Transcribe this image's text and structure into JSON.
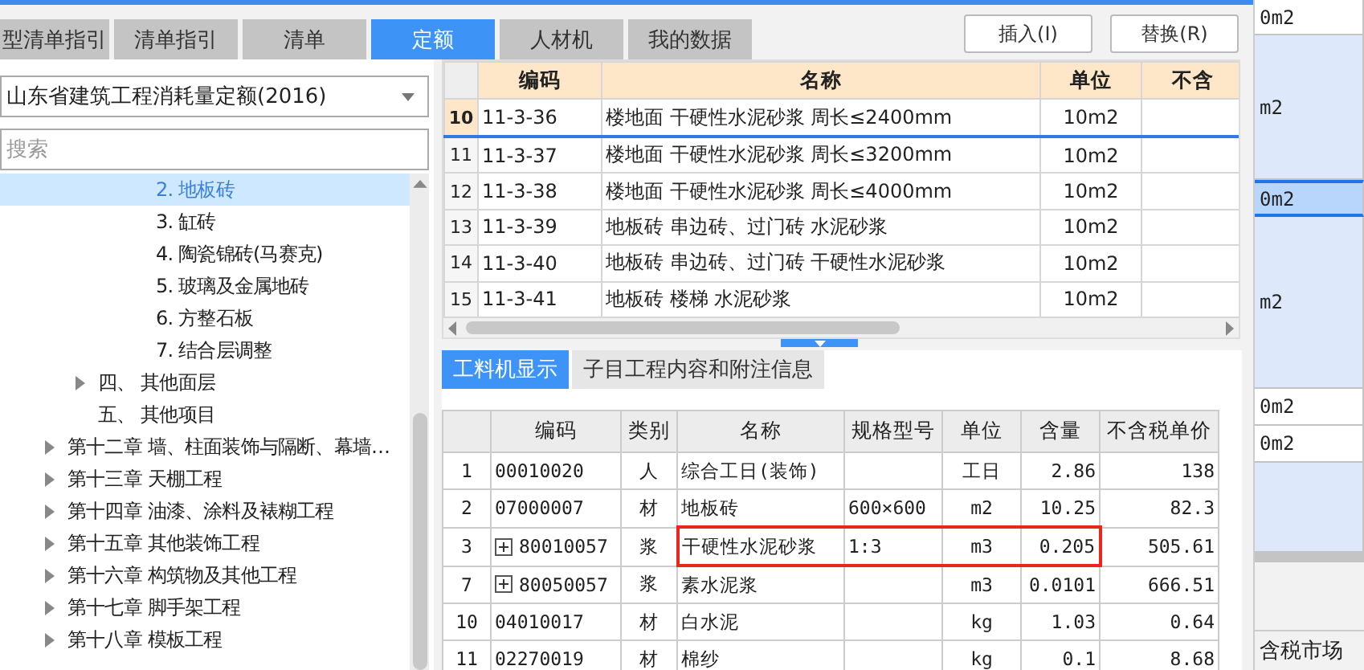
{
  "tabs": [
    {
      "label": "型清单指引",
      "selected": false
    },
    {
      "label": "清单指引",
      "selected": false
    },
    {
      "label": "清单",
      "selected": false
    },
    {
      "label": "定额",
      "selected": true
    },
    {
      "label": "人材机",
      "selected": false
    },
    {
      "label": "我的数据",
      "selected": false
    }
  ],
  "buttons": [
    "插入(I)",
    "替换(R)"
  ],
  "quota_select": {
    "value": "山东省建筑工程消耗量定额(2016)"
  },
  "search": {
    "placeholder": "搜索"
  },
  "tree": {
    "items": [
      {
        "children": [
          {
            "children": [
              {
                "label": "2. 地板砖",
                "kind": "leaf",
                "selected": true
              },
              {
                "label": "3. 缸砖",
                "kind": "leaf",
                "selected": false
              },
              {
                "label": "4. 陶瓷锦砖(马赛克)",
                "kind": "leaf",
                "selected": false
              },
              {
                "label": "5. 玻璃及金属地砖",
                "kind": "leaf",
                "selected": false
              },
              {
                "label": "6. 方整石板",
                "kind": "leaf",
                "selected": false
              },
              {
                "label": "7. 结合层调整",
                "kind": "leaf",
                "selected": false
              }
            ]
          },
          {
            "label": "四、 其他面层",
            "kind": "folder",
            "selected": false
          },
          {
            "label": "五、 其他项目",
            "kind": "leaf",
            "selected": false
          }
        ]
      },
      {
        "label": "第十二章 墙、柱面装饰与隔断、幕墙…",
        "kind": "folder",
        "selected": false
      },
      {
        "label": "第十三章 天棚工程",
        "kind": "folder",
        "selected": false
      },
      {
        "label": "第十四章 油漆、涂料及裱糊工程",
        "kind": "folder",
        "selected": false
      },
      {
        "label": "第十五章 其他装饰工程",
        "kind": "folder",
        "selected": false
      },
      {
        "label": "第十六章 构筑物及其他工程",
        "kind": "folder",
        "selected": false
      },
      {
        "label": "第十七章 脚手架工程",
        "kind": "folder",
        "selected": false
      },
      {
        "label": "第十八章 模板工程",
        "kind": "folder",
        "selected": false
      }
    ]
  },
  "quota_table": {
    "columns": [
      "编码",
      "名称",
      "单位",
      "不含"
    ],
    "rows": [
      {
        "index": "10",
        "code": "11-3-36",
        "name": "楼地面 干硬性水泥砂浆 周长≤2400mm",
        "unit": "10m2",
        "selected": true
      },
      {
        "index": "11",
        "code": "11-3-37",
        "name": "楼地面 干硬性水泥砂浆 周长≤3200mm",
        "unit": "10m2",
        "selected": false
      },
      {
        "index": "12",
        "code": "11-3-38",
        "name": "楼地面 干硬性水泥砂浆 周长≤4000mm",
        "unit": "10m2",
        "selected": false
      },
      {
        "index": "13",
        "code": "11-3-39",
        "name": "地板砖 串边砖、过门砖 水泥砂浆",
        "unit": "10m2",
        "selected": false
      },
      {
        "index": "14",
        "code": "11-3-40",
        "name": "地板砖 串边砖、过门砖 干硬性水泥砂浆",
        "unit": "10m2",
        "selected": false
      },
      {
        "index": "15",
        "code": "11-3-41",
        "name": "地板砖 楼梯 水泥砂浆",
        "unit": "10m2",
        "selected": false
      }
    ]
  },
  "detail_tabs": [
    {
      "label": "工料机显示",
      "selected": true
    },
    {
      "label": "子目工程内容和附注信息",
      "selected": false
    }
  ],
  "resource_table": {
    "columns": [
      "编码",
      "类别",
      "名称",
      "规格型号",
      "单位",
      "含量",
      "不含税单价"
    ],
    "rows": [
      {
        "index": "1",
        "kind": "item",
        "code": "00010020",
        "category": "人",
        "name": "综合工日(装饰)",
        "unit": "工日",
        "amount": "2.86",
        "price": "138",
        "highlighted": false
      },
      {
        "index": "2",
        "kind": "item",
        "code": "07000007",
        "category": "材",
        "name": "地板砖",
        "spec": "600×600",
        "unit": "m2",
        "amount": "10.25",
        "price": "82.3",
        "highlighted": false
      },
      {
        "index": "3",
        "kind": "group",
        "code": "80010057",
        "category": "浆",
        "name": "干硬性水泥砂浆",
        "spec": "1:3",
        "unit": "m3",
        "amount": "0.205",
        "price": "505.61",
        "highlighted": true
      },
      {
        "index": "7",
        "kind": "group",
        "code": "80050057",
        "category": "浆",
        "name": "素水泥浆",
        "unit": "m3",
        "amount": "0.0101",
        "price": "666.51",
        "highlighted": false
      },
      {
        "index": "10",
        "kind": "item",
        "code": "04010017",
        "category": "材",
        "name": "白水泥",
        "unit": "kg",
        "amount": "1.03",
        "price": "0.64",
        "highlighted": false
      },
      {
        "index": "11",
        "kind": "item",
        "code": "02270019",
        "category": "材",
        "name": "棉纱",
        "unit": "kg",
        "amount": "0.1",
        "price": "8.68",
        "highlighted": false
      }
    ]
  },
  "side_column": {
    "cells": [
      {
        "text": "0m2",
        "shaded": false,
        "selected": false
      },
      {
        "text": "m2",
        "shaded": true,
        "selected": false
      },
      {
        "text": "0m2",
        "shaded": true,
        "selected": true
      },
      {
        "text": "m2",
        "shaded": true,
        "selected": false
      },
      {
        "text": "0m2",
        "shaded": false,
        "selected": false
      },
      {
        "text": "0m2",
        "shaded": false,
        "selected": false
      },
      {
        "shaded": true,
        "selected": false
      }
    ],
    "header": "含税市场"
  }
}
